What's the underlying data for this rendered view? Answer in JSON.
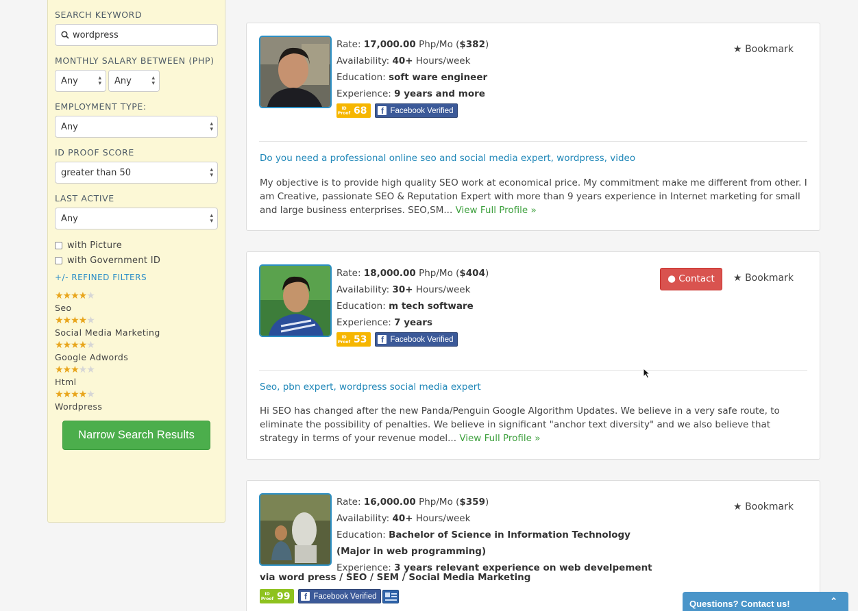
{
  "filters": {
    "search_keyword_label": "SEARCH KEYWORD",
    "search_value": "wordpress",
    "salary_label": "MONTHLY SALARY BETWEEN (PHP)",
    "salary_min": "Any",
    "salary_max": "Any",
    "employment_label": "EMPLOYMENT TYPE:",
    "employment_value": "Any",
    "idproof_label": "ID PROOF SCORE",
    "idproof_value": "greater than 50",
    "last_active_label": "LAST ACTIVE",
    "last_active_value": "Any",
    "with_picture": "with Picture",
    "with_gov_id": "with Government ID",
    "refined_label": "+/- REFINED FILTERS",
    "skills": [
      {
        "name": "Seo",
        "rating": 4
      },
      {
        "name": "Social Media Marketing",
        "rating": 4
      },
      {
        "name": "Google Adwords",
        "rating": 4
      },
      {
        "name": "Html",
        "rating": 3
      },
      {
        "name": "Wordpress",
        "rating": 4
      }
    ],
    "narrow_button": "Narrow Search Results"
  },
  "labels": {
    "rate": "Rate: ",
    "rate_unit": " Php/Mo (",
    "rate_close": ")",
    "availability": "Availability: ",
    "hours": " Hours/week",
    "education": "Education: ",
    "experience": "Experience: ",
    "bookmark": "Bookmark",
    "contact": "Contact",
    "facebook_verified": "Facebook Verified",
    "id_tag": "ID Proof",
    "view_full": "View Full Profile »"
  },
  "results": [
    {
      "rate": "17,000.00",
      "usd": "$382",
      "availability": "40+",
      "education": "soft ware engineer",
      "experience": "9 years and more",
      "id_score": "68",
      "headline": "Do you need a professional online seo and social media expert, wordpress, video",
      "description": "My objective is to provide high quality SEO work at economical price. My commitment make me different from other. I am Creative, passionate SEO & Reputation Expert with more than 9 years experience in Internet marketing for small and large business enterprises. SEO,SM..."
    },
    {
      "rate": "18,000.00",
      "usd": "$404",
      "availability": "30+",
      "education": "m tech software",
      "experience": "7 years",
      "id_score": "53",
      "headline": "Seo, pbn expert, wordpress social media expert",
      "description": "Hi SEO has changed after the new Panda/Penguin Google Algorithm Updates. We believe in a very safe route, to eliminate the possibility of penalties. We believe in significant \"anchor text diversity\" and we also believe that strategy in terms of your revenue model..."
    },
    {
      "rate": "16,000.00",
      "usd": "$359",
      "availability": "40+",
      "education_line1": "Bachelor of Science in Information Technology",
      "education_line2": "(Major in web programming)",
      "experience_line1": "3 years relevant experience on web develpement",
      "experience_line2": "via word press / SEO / SEM / Social Media Marketing",
      "id_score": "99"
    }
  ],
  "chat": {
    "label": "Questions? Contact us!"
  },
  "colors": {
    "accent_blue": "#2b8fc4",
    "green": "#4cae4c",
    "contact_red": "#d9534f",
    "sidebar_bg": "#fcf8d6"
  }
}
